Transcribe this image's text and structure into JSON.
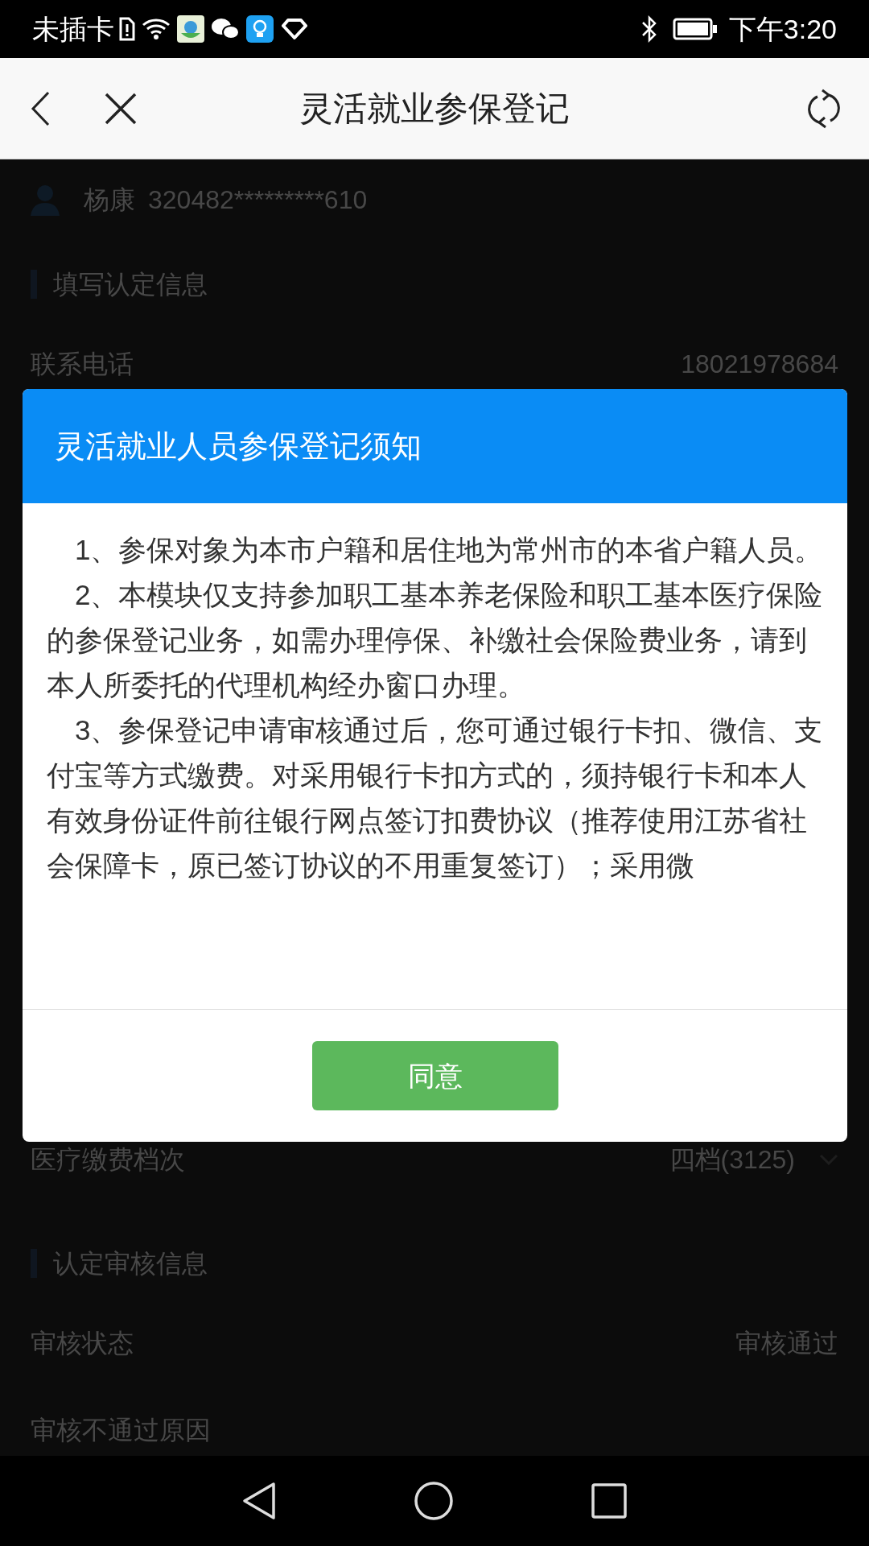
{
  "status_bar": {
    "carrier": "未插卡",
    "time": "下午3:20"
  },
  "header": {
    "title": "灵活就业参保登记"
  },
  "page": {
    "user_name": "杨康",
    "id_number": "320482*********610",
    "sections": [
      {
        "title": "填写认定信息",
        "rows": [
          {
            "label": "联系电话",
            "value": "18021978684",
            "kind": "text"
          },
          {
            "label": "医疗缴费档次",
            "value": "四档(3125)",
            "kind": "select"
          }
        ]
      },
      {
        "title": "认定审核信息",
        "rows": [
          {
            "label": "审核状态",
            "value": "审核通过",
            "kind": "text"
          },
          {
            "label": "审核不通过原因",
            "kind": "text"
          }
        ]
      }
    ]
  },
  "dialog": {
    "title": "灵活就业人员参保登记须知",
    "paragraphs": [
      "1、参保对象为本市户籍和居住地为常州市的本省户籍人员。",
      "2、本模块仅支持参加职工基本养老保险和职工基本医疗保险的参保登记业务，如需办理停保、补缴社会保险费业务，请到本人所委托的代理机构经办窗口办理。",
      "3、参保登记申请审核通过后，您可通过银行卡扣、微信、支付宝等方式缴费。对采用银行卡扣方式的，须持银行卡和本人有效身份证件前往银行网点签订扣费协议（推荐使用江苏省社会保障卡，原已签订协议的不用重复签订）；采用微"
    ],
    "button": "同意"
  }
}
